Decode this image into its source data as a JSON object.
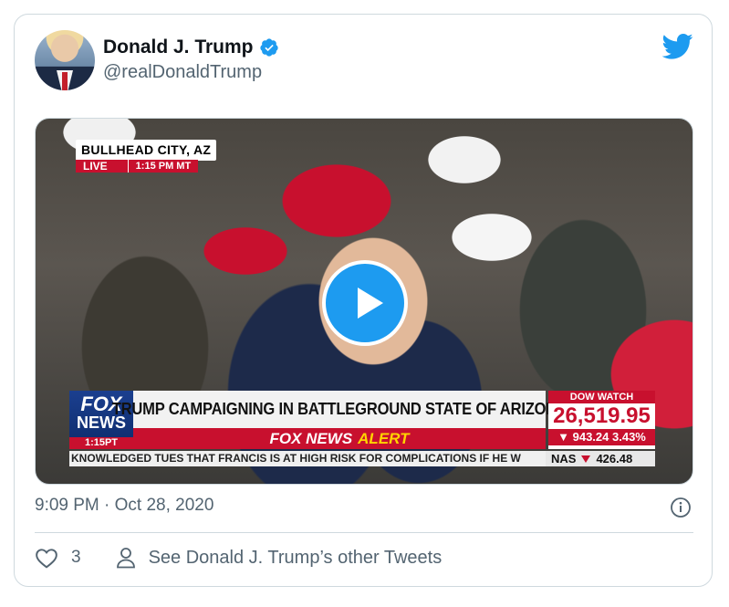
{
  "tweet": {
    "display_name": "Donald J. Trump",
    "handle": "@realDonaldTrump",
    "timestamp": "9:09 PM · Oct 28, 2020",
    "like_count": "3",
    "other_tweets_label": "See Donald J. Trump’s other Tweets"
  },
  "video": {
    "location": "BULLHEAD CITY, AZ",
    "live_label": "LIVE",
    "live_time": "1:15 PM MT",
    "network_top": "FOX",
    "network_bottom": "NEWS",
    "network_time": "1:15PT",
    "headline": "TRUMP CAMPAIGNING IN BATTLEGROUND STATE OF ARIZONA",
    "alert_prefix": "FOX NEWS",
    "alert_word": "ALERT",
    "dow_label": "DOW WATCH",
    "dow_value": "26,519.95",
    "dow_change": "▼ 943.24 3.43%",
    "ticker_text": "KNOWLEDGED TUES THAT FRANCIS IS AT HIGH RISK FOR COMPLICATIONS IF HE W",
    "nas_label": "NAS",
    "nas_value": "426.48"
  },
  "colors": {
    "twitter_blue": "#1d9bf0",
    "fox_red": "#c8102e",
    "fox_blue": "#1b3f8f",
    "muted_text": "#536471"
  },
  "icons": {
    "verified": "verified-badge-icon",
    "brand": "twitter-bird-icon",
    "info": "info-icon",
    "like": "heart-icon",
    "profile": "person-icon",
    "play": "play-icon"
  }
}
